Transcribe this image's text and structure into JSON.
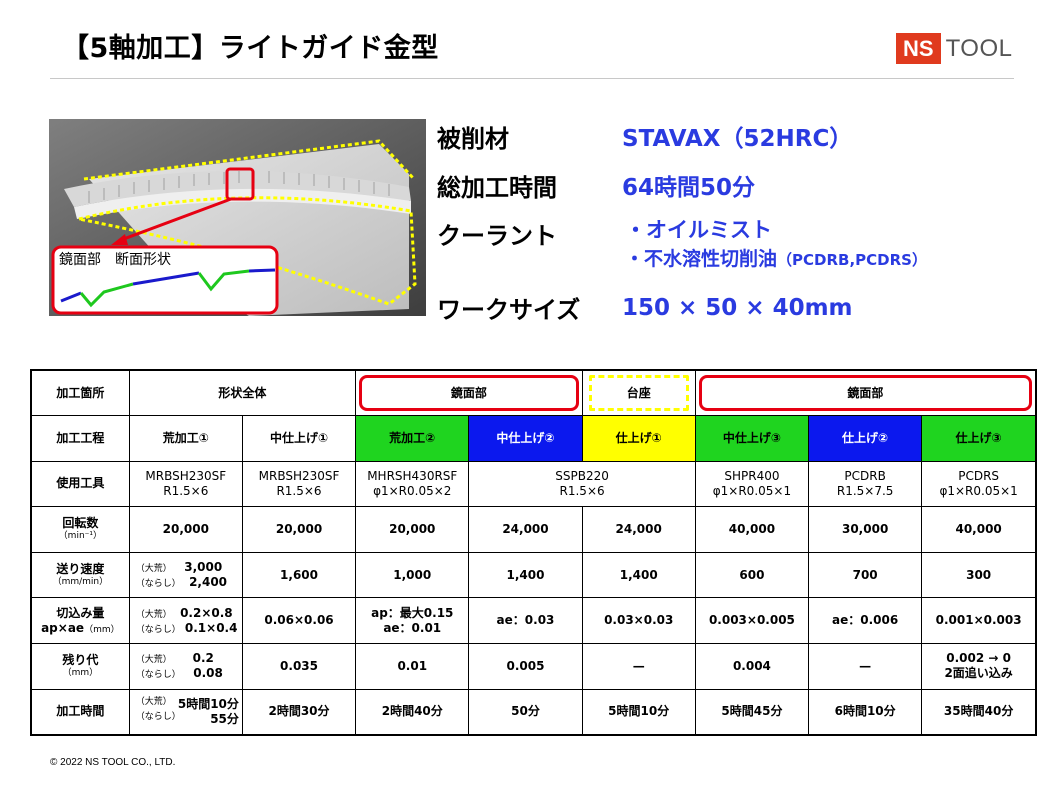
{
  "title": "【5軸加工】ライトガイド金型",
  "logo": {
    "ns": "NS",
    "tool": "TOOL"
  },
  "photo": {
    "inset_label": "鏡面部　断面形状"
  },
  "specs": {
    "material_label": "被削材",
    "material_value": "STAVAX（52HRC）",
    "time_label": "総加工時間",
    "time_value": "64時間50分",
    "coolant_label": "クーラント",
    "coolant_1": "・オイルミスト",
    "coolant_2_main": "・不水溶性切削油",
    "coolant_2_paren": "（PCDRB,PCDRS）",
    "size_label": "ワークサイズ",
    "size_value": "150 × 50 × 40mm"
  },
  "table": {
    "row_area": {
      "label": "加工箇所",
      "whole": "形状全体",
      "mirror1": "鏡面部",
      "base": "台座",
      "mirror2": "鏡面部"
    },
    "row_process": {
      "label": "加工工程",
      "c1": "荒加工①",
      "c2": "中仕上げ①",
      "c3": "荒加工②",
      "c4": "中仕上げ②",
      "c5": "仕上げ①",
      "c6": "中仕上げ③",
      "c7": "仕上げ②",
      "c8": "仕上げ③"
    },
    "row_tool": {
      "label": "使用工具",
      "c1a": "MRBSH230SF",
      "c1b": "R1.5×6",
      "c2a": "MRBSH230SF",
      "c2b": "R1.5×6",
      "c3a": "MHRSH430RSF",
      "c3b": "φ1×R0.05×2",
      "c45a": "SSPB220",
      "c45b": "R1.5×6",
      "c6a": "SHPR400",
      "c6b": "φ1×R0.05×1",
      "c7a": "PCDRB",
      "c7b": "R1.5×7.5",
      "c8a": "PCDRS",
      "c8b": "φ1×R0.05×1"
    },
    "row_rpm": {
      "label": "回転数",
      "unit": "（min⁻¹）",
      "c1": "20,000",
      "c2": "20,000",
      "c3": "20,000",
      "c4": "24,000",
      "c5": "24,000",
      "c6": "40,000",
      "c7": "30,000",
      "c8": "40,000"
    },
    "row_feed": {
      "label": "送り速度",
      "unit": "（mm/min）",
      "c1a_k": "（大荒）",
      "c1a_v": "3,000",
      "c1b_k": "（ならし）",
      "c1b_v": "2,400",
      "c2": "1,600",
      "c3": "1,000",
      "c4": "1,400",
      "c5": "1,400",
      "c6": "600",
      "c7": "700",
      "c8": "300"
    },
    "row_cut": {
      "label": "切込み量",
      "label2": "ap×ae",
      "unit": "（mm）",
      "c1a_k": "（大荒）",
      "c1a_v": "0.2×0.8",
      "c1b_k": "（ならし）",
      "c1b_v": "0.1×0.4",
      "c2": "0.06×0.06",
      "c3a": "ap：最大0.15",
      "c3b": "ae：0.01",
      "c4": "ae：0.03",
      "c5": "0.03×0.03",
      "c6": "0.003×0.005",
      "c7": "ae：0.006",
      "c8": "0.001×0.003"
    },
    "row_stock": {
      "label": "残り代",
      "unit": "（mm）",
      "c1a_k": "（大荒）",
      "c1a_v": "0.2",
      "c1b_k": "（ならし）",
      "c1b_v": "0.08",
      "c2": "0.035",
      "c3": "0.01",
      "c4": "0.005",
      "c5": "—",
      "c6": "0.004",
      "c7": "—",
      "c8a": "0.002 → 0",
      "c8b": "2面追い込み"
    },
    "row_time": {
      "label": "加工時間",
      "c1a_k": "（大荒）",
      "c1a_v": "5時間10分",
      "c1b_k": "（ならし）",
      "c1b_v": "55分",
      "c2": "2時間30分",
      "c3": "2時間40分",
      "c4": "50分",
      "c5": "5時間10分",
      "c6": "5時間45分",
      "c7": "6時間10分",
      "c8": "35時間40分"
    }
  },
  "colors": {
    "green": "#1fd41f",
    "blue": "#0b18ee",
    "yellow": "#ffff00",
    "red": "#e60012",
    "accent_text": "#2a3be0"
  },
  "copyright": "© 2022 NS TOOL CO., LTD."
}
